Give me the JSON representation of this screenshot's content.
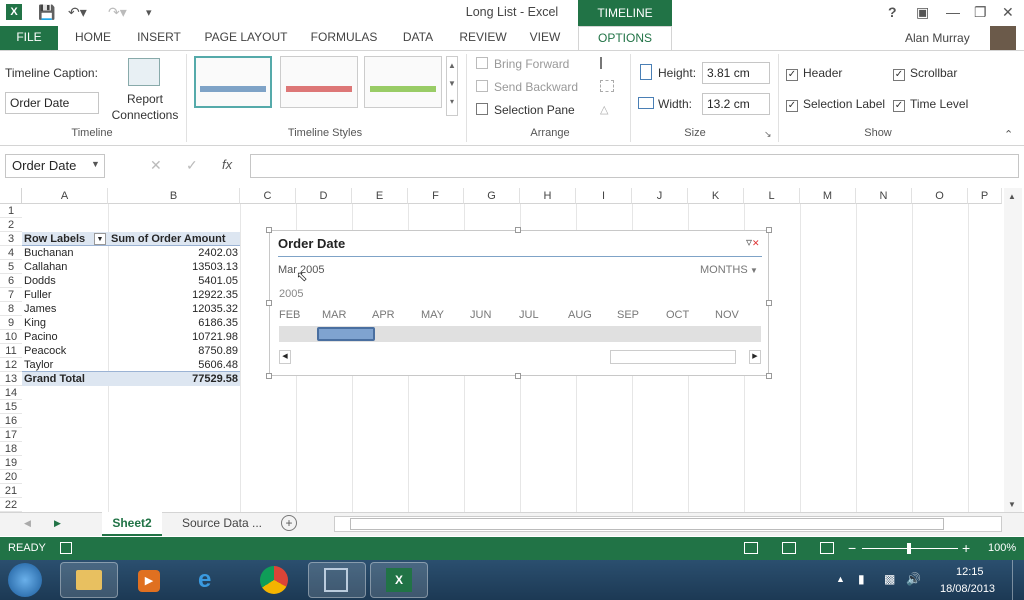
{
  "window": {
    "title": "Long List - Excel",
    "context_tab": "TIMELINE TOOLS",
    "user": "Alan Murray",
    "help": "?"
  },
  "tabs": [
    "FILE",
    "HOME",
    "INSERT",
    "PAGE LAYOUT",
    "FORMULAS",
    "DATA",
    "REVIEW",
    "VIEW",
    "OPTIONS"
  ],
  "ribbon": {
    "timeline_caption_label": "Timeline Caption:",
    "timeline_caption_value": "Order Date",
    "report_connections": "Report Connections",
    "group_timeline": "Timeline",
    "group_styles": "Timeline Styles",
    "bring_forward": "Bring Forward",
    "send_backward": "Send Backward",
    "selection_pane": "Selection Pane",
    "group_arrange": "Arrange",
    "height_label": "Height:",
    "height_value": "3.81 cm",
    "width_label": "Width:",
    "width_value": "13.2 cm",
    "group_size": "Size",
    "header": "Header",
    "scrollbar": "Scrollbar",
    "selection_label": "Selection Label",
    "time_level": "Time Level",
    "group_show": "Show"
  },
  "formula_bar": {
    "name_box": "Order Date",
    "fx": "fx"
  },
  "columns": [
    "A",
    "B",
    "C",
    "D",
    "E",
    "F",
    "G",
    "H",
    "I",
    "J",
    "K",
    "L",
    "M",
    "N",
    "O",
    "P"
  ],
  "rows": [
    "1",
    "2",
    "3",
    "4",
    "5",
    "6",
    "7",
    "8",
    "9",
    "10",
    "11",
    "12",
    "13",
    "14",
    "15",
    "16",
    "17",
    "18",
    "19",
    "20",
    "21",
    "22"
  ],
  "pivot": {
    "header_labels": "Row Labels",
    "header_sum": "Sum of Order Amount",
    "items": [
      {
        "name": "Buchanan",
        "value": "2402.03"
      },
      {
        "name": "Callahan",
        "value": "13503.13"
      },
      {
        "name": "Dodds",
        "value": "5401.05"
      },
      {
        "name": "Fuller",
        "value": "12922.35"
      },
      {
        "name": "James",
        "value": "12035.32"
      },
      {
        "name": "King",
        "value": "6186.35"
      },
      {
        "name": "Pacino",
        "value": "10721.98"
      },
      {
        "name": "Peacock",
        "value": "8750.89"
      },
      {
        "name": "Taylor",
        "value": "5606.48"
      }
    ],
    "total_label": "Grand Total",
    "total_value": "77529.58"
  },
  "timeline": {
    "caption": "Order Date",
    "selection": "Mar 2005",
    "level": "MONTHS",
    "year": "2005",
    "months": [
      "FEB",
      "MAR",
      "APR",
      "MAY",
      "JUN",
      "JUL",
      "AUG",
      "SEP",
      "OCT",
      "NOV"
    ]
  },
  "sheets": {
    "tabs": [
      "Sheet2",
      "Source Data ..."
    ],
    "active": "Sheet2"
  },
  "status": {
    "ready": "READY",
    "zoom": "100%"
  },
  "taskbar": {
    "time": "12:15",
    "date": "18/08/2013"
  }
}
